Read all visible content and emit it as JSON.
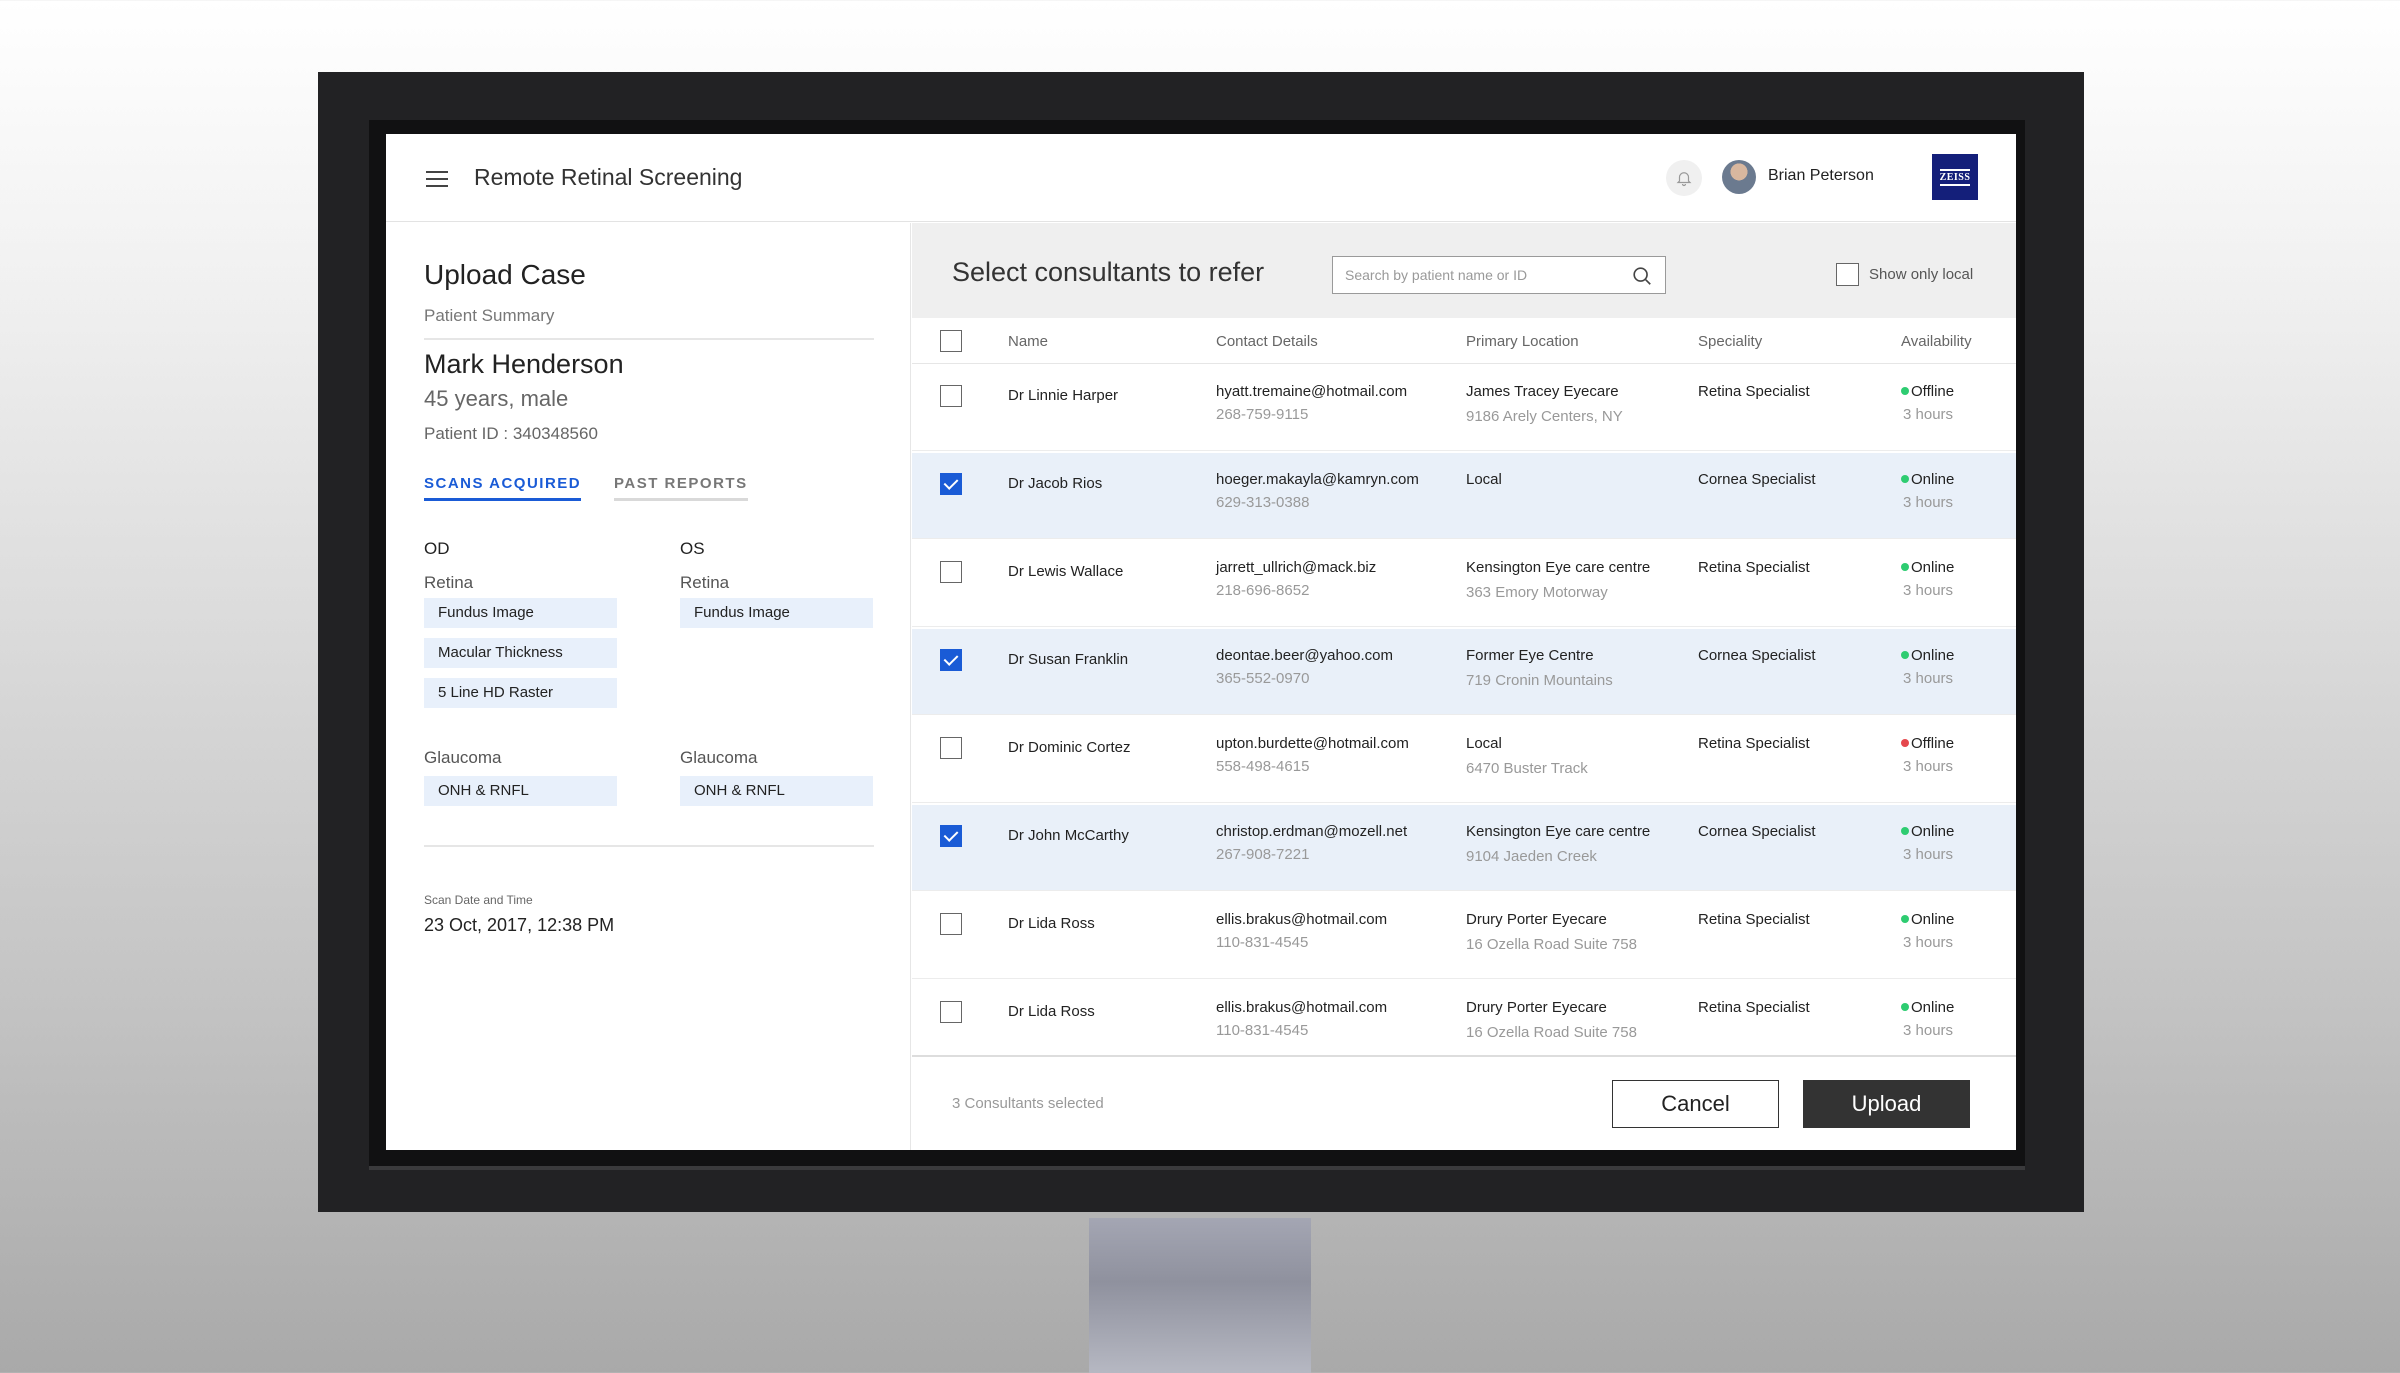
{
  "app": {
    "title": "Remote Retinal Screening"
  },
  "user": {
    "name": "Brian Peterson"
  },
  "brand": {
    "logo_text": "ZEISS",
    "color": "#141f7a"
  },
  "colors": {
    "accent": "#1a5bd6",
    "online": "#2ecc71",
    "offline": "#e5484d",
    "selected_row": "#e9f0f9"
  },
  "case": {
    "title": "Upload Case",
    "section": "Patient Summary",
    "patient_name": "Mark Henderson",
    "age_sex": "45 years, male",
    "patient_id": "Patient ID : 340348560",
    "tabs": [
      "SCANS ACQUIRED",
      "PAST REPORTS"
    ],
    "od": {
      "label": "OD",
      "retina_label": "Retina",
      "retina_scans": [
        "Fundus Image",
        "Macular Thickness",
        "5 Line HD Raster"
      ],
      "glaucoma_label": "Glaucoma",
      "glaucoma_scans": [
        "ONH & RNFL"
      ]
    },
    "os": {
      "label": "OS",
      "retina_label": "Retina",
      "retina_scans": [
        "Fundus Image"
      ],
      "glaucoma_label": "Glaucoma",
      "glaucoma_scans": [
        "ONH & RNFL"
      ]
    },
    "scan_datetime_label": "Scan Date and Time",
    "scan_datetime": "23 Oct, 2017, 12:38 PM"
  },
  "consultants": {
    "title": "Select consultants to refer",
    "search_placeholder": "Search by patient name or ID",
    "show_local_label": "Show only local",
    "show_local_checked": false,
    "columns": [
      "Name",
      "Contact Details",
      "Primary Location",
      "Speciality",
      "Availability"
    ],
    "rows": [
      {
        "checked": false,
        "name": "Dr Linnie Harper",
        "email": "hyatt.tremaine@hotmail.com",
        "phone": "268-759-9115",
        "location": "James Tracey Eyecare",
        "address": "9186 Arely Centers, NY",
        "speciality": "Retina Specialist",
        "status": "Offline",
        "status_color": "#2ecc71",
        "time": "3 hours"
      },
      {
        "checked": true,
        "name": "Dr Jacob Rios",
        "email": "hoeger.makayla@kamryn.com",
        "phone": "629-313-0388",
        "location": "Local",
        "address": "",
        "speciality": "Cornea Specialist",
        "status": "Online",
        "status_color": "#2ecc71",
        "time": "3 hours"
      },
      {
        "checked": false,
        "name": "Dr Lewis Wallace",
        "email": "jarrett_ullrich@mack.biz",
        "phone": "218-696-8652",
        "location": "Kensington Eye care centre",
        "address": "363 Emory Motorway",
        "speciality": "Retina Specialist",
        "status": "Online",
        "status_color": "#2ecc71",
        "time": "3 hours"
      },
      {
        "checked": true,
        "name": "Dr Susan Franklin",
        "email": "deontae.beer@yahoo.com",
        "phone": "365-552-0970",
        "location": "Former Eye Centre",
        "address": "719 Cronin Mountains",
        "speciality": "Cornea Specialist",
        "status": "Online",
        "status_color": "#2ecc71",
        "time": "3 hours"
      },
      {
        "checked": false,
        "name": "Dr Dominic Cortez",
        "email": "upton.burdette@hotmail.com",
        "phone": "558-498-4615",
        "location": "Local",
        "address": "6470 Buster Track",
        "speciality": "Retina Specialist",
        "status": "Offline",
        "status_color": "#e5484d",
        "time": "3 hours"
      },
      {
        "checked": true,
        "name": "Dr John McCarthy",
        "email": "christop.erdman@mozell.net",
        "phone": "267-908-7221",
        "location": "Kensington Eye care centre",
        "address": "9104 Jaeden Creek",
        "speciality": "Cornea Specialist",
        "status": "Online",
        "status_color": "#2ecc71",
        "time": "3 hours"
      },
      {
        "checked": false,
        "name": "Dr Lida Ross",
        "email": "ellis.brakus@hotmail.com",
        "phone": "110-831-4545",
        "location": "Drury Porter Eyecare",
        "address": "16 Ozella Road Suite 758",
        "speciality": "Retina Specialist",
        "status": "Online",
        "status_color": "#2ecc71",
        "time": "3 hours"
      },
      {
        "checked": false,
        "name": "Dr Lida Ross",
        "email": "ellis.brakus@hotmail.com",
        "phone": "110-831-4545",
        "location": "Drury Porter Eyecare",
        "address": "16 Ozella Road Suite 758",
        "speciality": "Retina Specialist",
        "status": "Online",
        "status_color": "#2ecc71",
        "time": "3 hours"
      }
    ],
    "selected_count": "3 Consultants selected",
    "cancel_label": "Cancel",
    "upload_label": "Upload"
  }
}
